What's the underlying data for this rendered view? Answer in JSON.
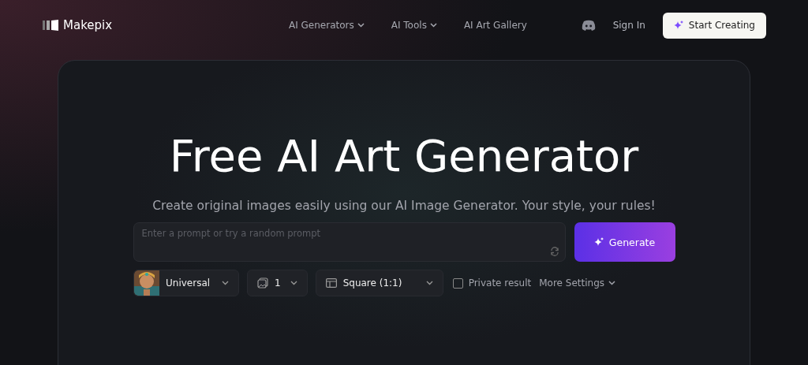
{
  "header": {
    "logo": "Makepix",
    "nav": [
      {
        "label": "AI Generators",
        "dropdown": true
      },
      {
        "label": "AI Tools",
        "dropdown": true
      },
      {
        "label": "AI Art Gallery",
        "dropdown": false
      }
    ],
    "sign_in": "Sign In",
    "cta": "Start Creating"
  },
  "hero": {
    "title": "Free AI Art Generator",
    "subtitle": "Create original images easily using our AI Image Generator. Your style, your rules!"
  },
  "prompt": {
    "placeholder": "Enter a prompt or try a random prompt",
    "generate": "Generate"
  },
  "options": {
    "model": "Universal",
    "count": "1",
    "ratio": "Square (1:1)",
    "private": {
      "label": "Private result",
      "checked": false
    },
    "more": "More Settings"
  }
}
